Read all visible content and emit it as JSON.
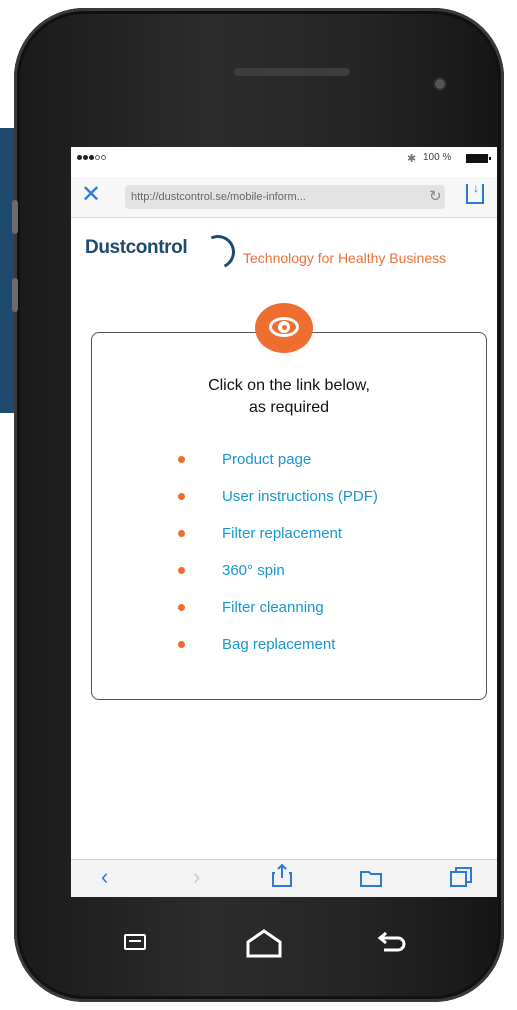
{
  "status_bar": {
    "battery": "100 %",
    "bluetooth_icon": "bluetooth-icon"
  },
  "browser": {
    "url": "http://dustcontrol.se/mobile-inform...",
    "close_icon": "close-icon",
    "reload_icon": "reload-icon",
    "share_icon": "download-icon"
  },
  "header": {
    "logo_text": "Dustcontrol",
    "tagline": "Technology for Healthy Business"
  },
  "card": {
    "line1": "Click on the link below,",
    "line2": "as required",
    "links": [
      "Product page",
      "User instructions (PDF)",
      "Filter replacement",
      "360° spin",
      "Filter cleanning",
      "Bag replacement"
    ]
  },
  "colors": {
    "accent_orange": "#ee6e2f",
    "link_blue": "#1797d1",
    "brand_blue": "#1c4b6d",
    "ios_blue": "#2d7ad6"
  }
}
